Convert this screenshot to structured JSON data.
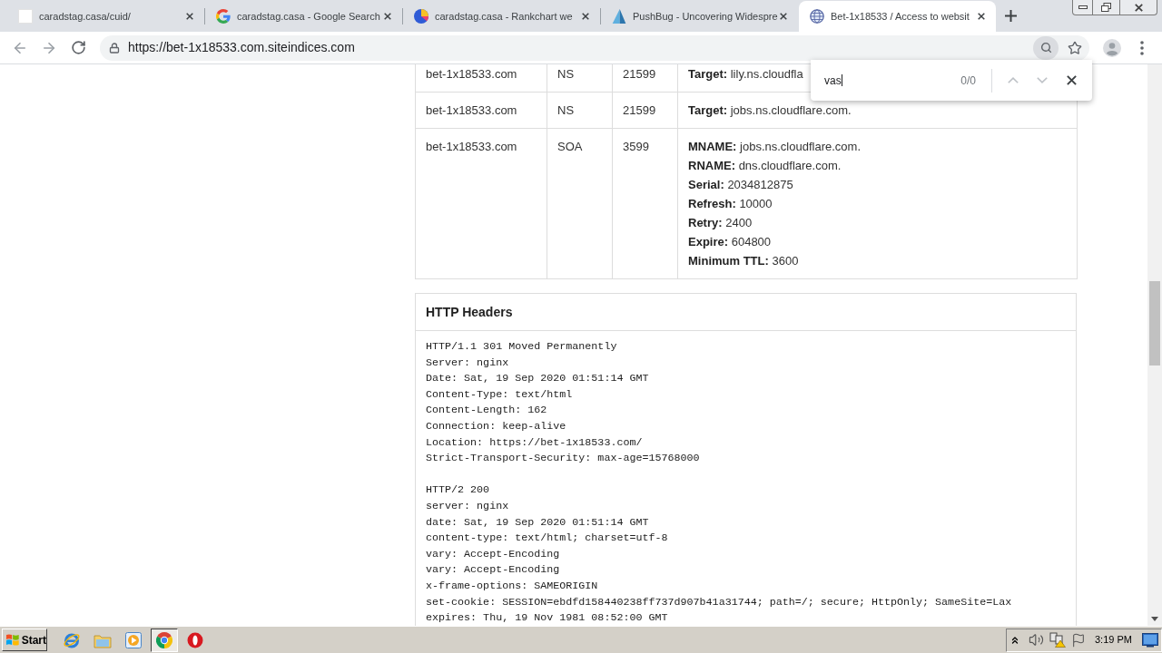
{
  "browser": {
    "tabs": [
      {
        "title": "caradstag.casa/cuid/",
        "kind": "blank",
        "selected": false
      },
      {
        "title": "caradstag.casa - Google Search",
        "kind": "google",
        "selected": false
      },
      {
        "title": "caradstag.casa - Rankchart we",
        "kind": "pie",
        "selected": false
      },
      {
        "title": "PushBug - Uncovering Widespre",
        "kind": "sail",
        "selected": false
      },
      {
        "title": "Bet-1x18533 / Access to websit",
        "kind": "globe",
        "selected": true
      }
    ],
    "address_bar": {
      "url": "https://bet-1x18533.com.siteindices.com"
    },
    "find_bar": {
      "value": "vas",
      "count": "0/0",
      "nav_disabled": true
    }
  },
  "dns_table": {
    "rows": [
      {
        "column_1": "bet-1x18533.com",
        "column_2": "NS",
        "column_3": "21599",
        "column_4": [
          {
            "label": "Target:",
            "value": "lily.ns.cloudfla"
          }
        ]
      },
      {
        "column_1": "bet-1x18533.com",
        "column_2": "NS",
        "column_3": "21599",
        "column_4": [
          {
            "label": "Target:",
            "value": "jobs.ns.cloudflare.com."
          }
        ]
      },
      {
        "column_1": "bet-1x18533.com",
        "column_2": "SOA",
        "column_3": "3599",
        "column_4": [
          {
            "label": "MNAME:",
            "value": "jobs.ns.cloudflare.com."
          },
          {
            "label": "RNAME:",
            "value": "dns.cloudflare.com."
          },
          {
            "label": "Serial:",
            "value": "2034812875"
          },
          {
            "label": "Refresh:",
            "value": "10000"
          },
          {
            "label": "Retry:",
            "value": "2400"
          },
          {
            "label": "Expire:",
            "value": "604800"
          },
          {
            "label": "Minimum TTL:",
            "value": "3600"
          }
        ]
      }
    ]
  },
  "http_headers": {
    "title": "HTTP Headers",
    "responses": [
      {
        "lines": [
          "HTTP/1.1 301 Moved Permanently",
          "Server: nginx",
          "Date: Sat, 19 Sep 2020 01:51:14 GMT",
          "Content-Type: text/html",
          "Content-Length: 162",
          "Connection: keep-alive",
          "Location: https://bet-1x18533.com/",
          "Strict-Transport-Security: max-age=15768000"
        ]
      },
      {
        "lines": [
          "HTTP/2 200",
          "server: nginx",
          "date: Sat, 19 Sep 2020 01:51:14 GMT",
          "content-type: text/html; charset=utf-8",
          "vary: Accept-Encoding",
          "vary: Accept-Encoding",
          "x-frame-options: SAMEORIGIN",
          "set-cookie: SESSION=ebdfd158440238ff737d907b41a31744; path=/; secure; HttpOnly; SameSite=Lax",
          "expires: Thu, 19 Nov 1981 08:52:00 GMT"
        ]
      }
    ]
  },
  "taskbar": {
    "start_label": "Start",
    "apps": [
      {
        "kind": "ie",
        "selected": false
      },
      {
        "kind": "folder",
        "selected": false
      },
      {
        "kind": "media",
        "selected": false
      },
      {
        "kind": "chrome",
        "selected": true
      },
      {
        "kind": "opera",
        "selected": false
      }
    ],
    "clock": "3:19 PM"
  }
}
